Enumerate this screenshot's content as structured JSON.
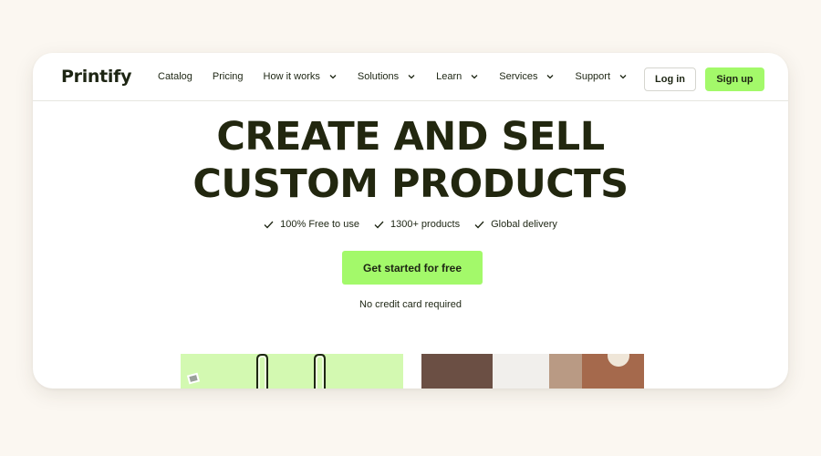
{
  "brand": {
    "logo_text": "Printify",
    "accent_color": "#a3f96a",
    "text_color": "#1d2513"
  },
  "nav": {
    "items": [
      {
        "label": "Catalog",
        "has_dropdown": false
      },
      {
        "label": "Pricing",
        "has_dropdown": false
      },
      {
        "label": "How it works",
        "has_dropdown": true
      },
      {
        "label": "Solutions",
        "has_dropdown": true
      },
      {
        "label": "Learn",
        "has_dropdown": true
      },
      {
        "label": "Services",
        "has_dropdown": true
      },
      {
        "label": "Support",
        "has_dropdown": true
      }
    ],
    "login_label": "Log in",
    "signup_label": "Sign up"
  },
  "hero": {
    "headline_line1": "CREATE AND SELL",
    "headline_line2": "CUSTOM PRODUCTS",
    "features": [
      "100% Free to use",
      "1300+ products",
      "Global delivery"
    ],
    "cta_label": "Get started for free",
    "subnote": "No credit card required"
  }
}
